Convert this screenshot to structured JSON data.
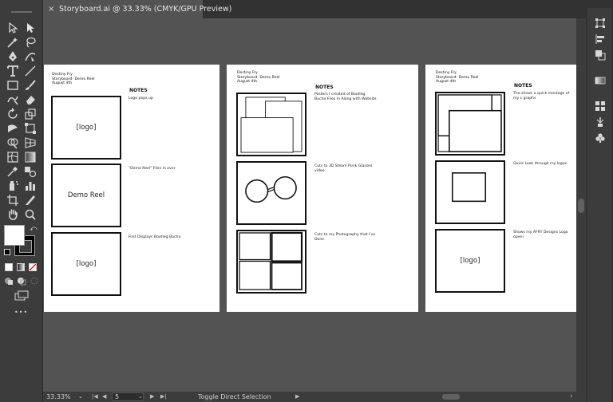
{
  "window": {
    "tab_title": "Storyboard.ai @ 33.33% (CMYK/GPU Preview)",
    "close_glyph": "×"
  },
  "toolbar": {
    "tools": [
      "selection-tool-icon",
      "direct-selection-tool-icon",
      "pen-tool-icon",
      "curvature-tool-icon",
      "type-tool-icon",
      "line-tool-icon",
      "rectangle-tool-icon",
      "paintbrush-tool-icon",
      "shaper-tool-icon",
      "eraser-tool-icon",
      "rotate-tool-icon",
      "scale-tool-icon",
      "warp-tool-icon",
      "free-transform-tool-icon",
      "shape-builder-tool-icon",
      "perspective-grid-tool-icon",
      "mesh-tool-icon",
      "gradient-tool-icon",
      "eyedropper-tool-icon",
      "blend-tool-icon",
      "symbol-sprayer-tool-icon",
      "column-graph-tool-icon",
      "artboard-tool-icon",
      "slice-tool-icon",
      "hand-tool-icon",
      "zoom-tool-icon"
    ],
    "more_glyph": "•••",
    "swap_glyph": "⤺"
  },
  "artboards": [
    {
      "header": [
        "Destiny Fry",
        "Storyboard- Demo Reel",
        "August 4th"
      ],
      "notes_heading": "NOTES",
      "panels": [
        {
          "label": "[logo]",
          "note": "Logo pops up"
        },
        {
          "label": "Demo Reel",
          "note": "\"Demo Reel\" Flies in over"
        },
        {
          "label": "[logo]",
          "note": "First Displays Bootleg Bucha"
        }
      ]
    },
    {
      "header": [
        "Destiny Fry",
        "Storyboard- Demo Reel",
        "August 4th"
      ],
      "notes_heading": "NOTES",
      "panels": [
        {
          "label": "",
          "note": "Posters I created of Bootleg Bucha Flies In Along with Website"
        },
        {
          "label": "",
          "note": "Cuts to 3D Steam Punk Glasses video"
        },
        {
          "label": "",
          "note": "Cuts to my Photography that I've Done"
        }
      ]
    },
    {
      "header": [
        "Destiny Fry",
        "Storyboard- Demo Reel",
        "August 4th"
      ],
      "notes_heading": "NOTES",
      "panels": [
        {
          "label": "",
          "note": "The shows a quick montage of my c graphs"
        },
        {
          "label": "",
          "note": "Quick Look through my logos"
        },
        {
          "label": "[logo]",
          "note": "Shows my AFRY Designs Logo openi"
        }
      ]
    }
  ],
  "statusbar": {
    "zoom": "33.33%",
    "page": "5",
    "status_text": "Toggle Direct Selection",
    "caret": "⌄",
    "first_glyph": "|◀",
    "prev_glyph": "◀",
    "next_glyph": "▶",
    "last_glyph": "▶|",
    "play_glyph": "▶",
    "right_glyph": "›"
  }
}
